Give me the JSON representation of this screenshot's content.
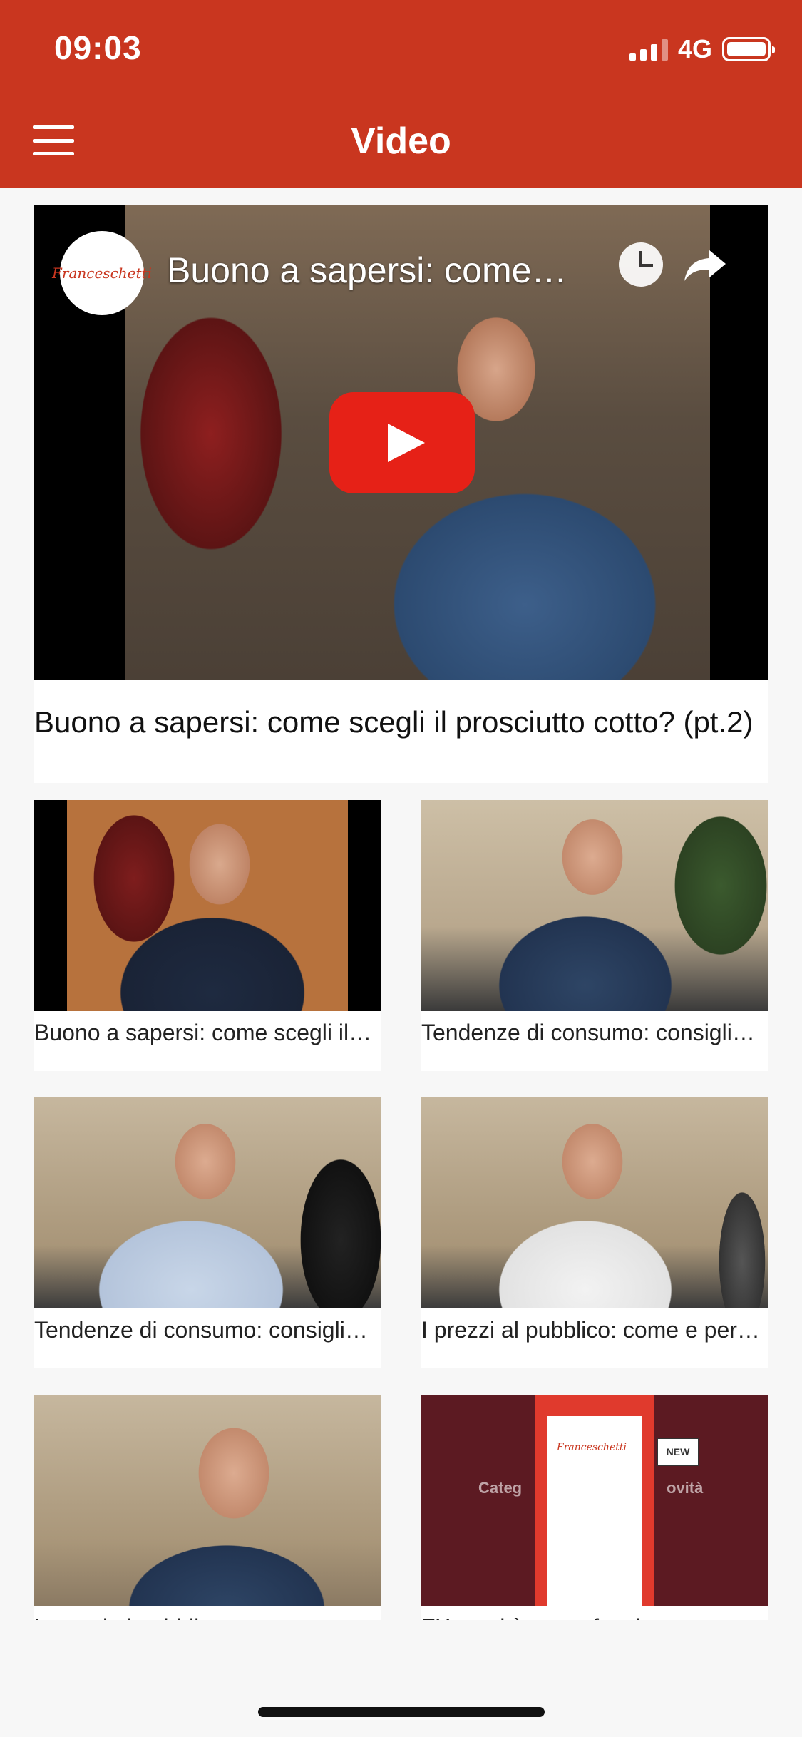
{
  "status_bar": {
    "time": "09:03",
    "network": "4G"
  },
  "header": {
    "title": "Video"
  },
  "featured": {
    "overlay_title": "Buono a sapersi: come…",
    "title": "Buono a sapersi: come scegli il prosciutto cotto? (pt.2)",
    "channel_logo_text": "Franceschetti"
  },
  "videos": [
    {
      "caption": "Buono a sapersi: come scegli il…"
    },
    {
      "caption": "Tendenze di consumo: consigli…"
    },
    {
      "caption": "Tendenze di consumo: consigli…"
    },
    {
      "caption": "I prezzi al pubblico: come e per…"
    },
    {
      "caption": "I prezzi al pubblico: come e per…"
    },
    {
      "caption": "FX: novità come funziona…"
    }
  ],
  "thumb_f": {
    "logo": "Franceschetti",
    "new_badge": "NEW",
    "categ": "Categ",
    "novita": "ovità"
  },
  "colors": {
    "brand_red": "#c9361f",
    "youtube_red": "#e62117"
  }
}
